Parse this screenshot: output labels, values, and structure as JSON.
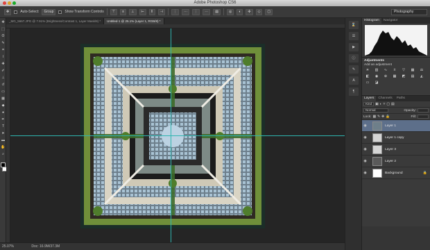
{
  "window": {
    "title": "Adobe Photoshop CS6"
  },
  "options_bar": {
    "auto_select_label": "Auto-Select:",
    "auto_select_value": "Group",
    "transform_label": "Show Transform Controls",
    "workspace": "Photography"
  },
  "tabs": [
    {
      "label": "_MG_5667.JPG @ 7.91% (Brightness/Contrast 1, Layer Mask/8) *",
      "active": false
    },
    {
      "label": "Untitled-1 @ 25.1% (Layer 1, RGB/8) *",
      "active": true
    }
  ],
  "status": {
    "zoom": "25.07%",
    "doc": "Doc: 16.9M/37.3M"
  },
  "panels": {
    "histogram_tabs": [
      "Histogram",
      "Navigator"
    ],
    "adjustments_tab": "Adjustments",
    "adjustments_label": "Add an adjustment",
    "layers_tabs": [
      "Layers",
      "Channels",
      "Paths"
    ],
    "kind": "Kind",
    "blend_mode": "Normal",
    "opacity_label": "Opacity:",
    "lock_label": "Lock:",
    "fill_label": "Fill:"
  },
  "layers": [
    {
      "name": "Layer 1",
      "selected": true
    },
    {
      "name": "Layer 1 copy",
      "selected": false
    },
    {
      "name": "Layer 3",
      "selected": false
    },
    {
      "name": "Layer 2",
      "selected": false
    },
    {
      "name": "Background",
      "selected": false,
      "locked": true
    }
  ],
  "colors": {
    "guide": "#2fb5b0",
    "selection": "#5d6f8a",
    "canvas_bg": "#252525"
  }
}
